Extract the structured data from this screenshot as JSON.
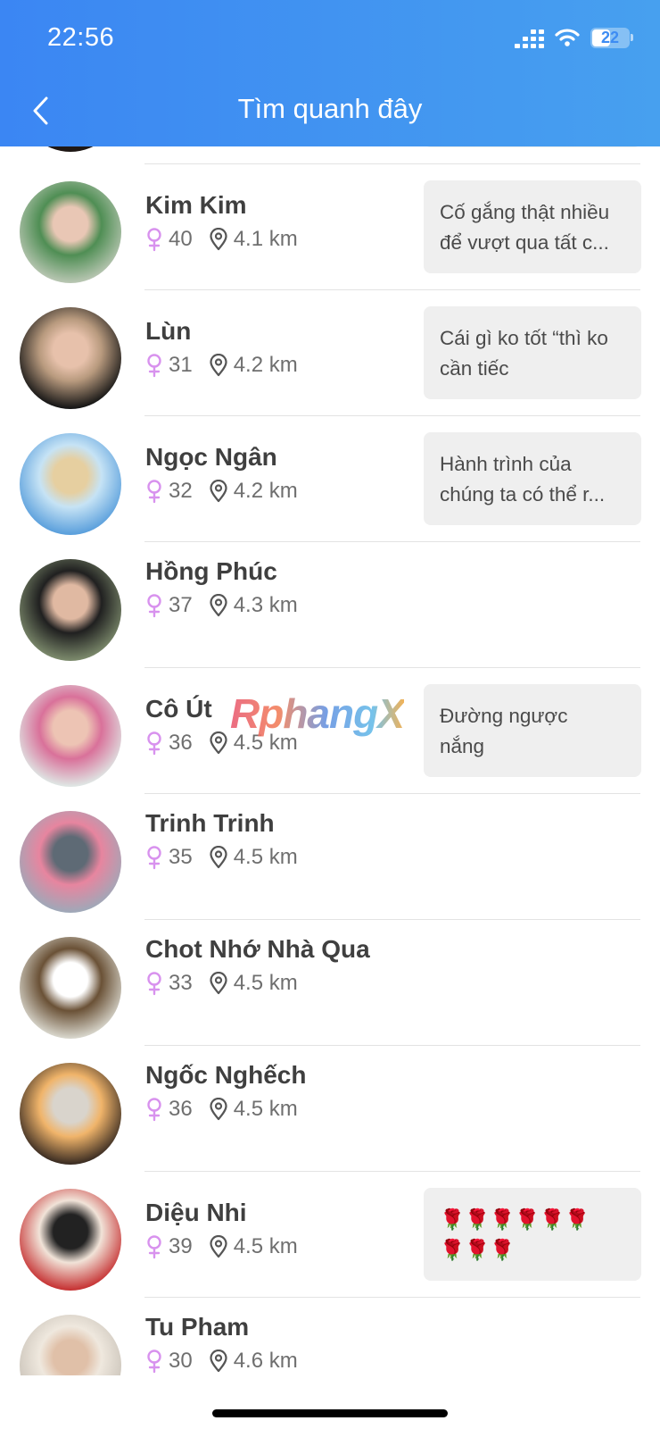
{
  "status_bar": {
    "time": "22:56",
    "battery": "22"
  },
  "header": {
    "title": "Tìm quanh đây"
  },
  "users": [
    {
      "name": "Kim Kim",
      "age": "40",
      "distance": "4.1 km",
      "status_lines": [
        "Cố gắng thật nhiều",
        "để vượt qua tất c..."
      ],
      "colors": [
        "#b8c6b2",
        "#4f8e54",
        "#e9c7b5"
      ]
    },
    {
      "name": "Lùn",
      "age": "31",
      "distance": "4.2 km",
      "status_lines": [
        "Cái gì ko tốt “thì ko",
        "cần tiếc"
      ],
      "colors": [
        "#151515",
        "#b89a7e",
        "#e7c1ab"
      ]
    },
    {
      "name": "Ngọc Ngân",
      "age": "32",
      "distance": "4.2 km",
      "status_lines": [
        "Hành trình của",
        "chúng ta có thể r..."
      ],
      "colors": [
        "#5a9fdc",
        "#c6e3f5",
        "#e6cfa0"
      ]
    },
    {
      "name": "Hồng Phúc",
      "age": "37",
      "distance": "4.3 km",
      "status_lines": [],
      "colors": [
        "#7c8a6c",
        "#202020",
        "#e0b9a2"
      ]
    },
    {
      "name": "Cô Út",
      "age": "36",
      "distance": "4.5 km",
      "status_lines": [
        "Đường ngược",
        "nắng"
      ],
      "colors": [
        "#dfe6e4",
        "#d9719a",
        "#edc4b4"
      ]
    },
    {
      "name": "Trinh Trinh",
      "age": "35",
      "distance": "4.5 km",
      "status_lines": [],
      "colors": [
        "#9fa8b8",
        "#e7859f",
        "#5e6a75"
      ]
    },
    {
      "name": "Chot Nhớ Nhà Qua",
      "age": "33",
      "distance": "4.5 km",
      "status_lines": [],
      "colors": [
        "#d8d6cc",
        "#6a5136",
        "#ffffff"
      ]
    },
    {
      "name": "Ngốc Nghếch",
      "age": "36",
      "distance": "4.5 km",
      "status_lines": [],
      "colors": [
        "#3a2c22",
        "#f0b46a",
        "#d9d4cc"
      ]
    },
    {
      "name": "Diệu Nhi",
      "age": "39",
      "distance": "4.5 km",
      "status_lines": [
        "🌹🌹🌹🌹🌹🌹",
        "🌹🌹🌹"
      ],
      "colors": [
        "#c63233",
        "#f1e3d8",
        "#222222"
      ]
    },
    {
      "name": "Tu Pham",
      "age": "30",
      "distance": "4.6 km",
      "status_lines": [],
      "colors": [
        "#c9c2b8",
        "#efe8de",
        "#e0c0a8"
      ]
    }
  ],
  "watermark": "RphangX",
  "colors": {
    "header_start": "#3b86f3",
    "header_end": "#47a0ef",
    "gender_icon": "#d892ee",
    "bubble_bg": "#efefef"
  }
}
